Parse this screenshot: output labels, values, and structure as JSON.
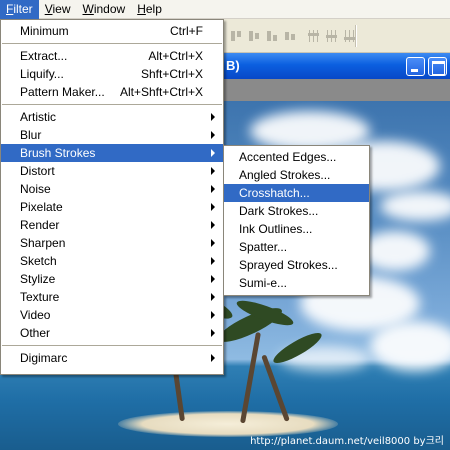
{
  "menubar": {
    "items": [
      {
        "label": "Filter",
        "mnemonic": "F"
      },
      {
        "label": "View",
        "mnemonic": "V"
      },
      {
        "label": "Window",
        "mnemonic": "W"
      },
      {
        "label": "Help",
        "mnemonic": "H"
      }
    ],
    "active": "Filter"
  },
  "document": {
    "title_fragment": "B)",
    "watermark": "http://planet.daum.net/veil8000 by크리"
  },
  "filter_menu": {
    "groups": [
      [
        {
          "label": "Minimum",
          "shortcut": "Ctrl+F"
        }
      ],
      [
        {
          "label": "Extract...",
          "shortcut": "Alt+Ctrl+X"
        },
        {
          "label": "Liquify...",
          "shortcut": "Shft+Ctrl+X"
        },
        {
          "label": "Pattern Maker...",
          "shortcut": "Alt+Shft+Ctrl+X"
        }
      ],
      [
        {
          "label": "Artistic",
          "submenu": true
        },
        {
          "label": "Blur",
          "submenu": true
        },
        {
          "label": "Brush Strokes",
          "submenu": true,
          "highlighted": true
        },
        {
          "label": "Distort",
          "submenu": true
        },
        {
          "label": "Noise",
          "submenu": true
        },
        {
          "label": "Pixelate",
          "submenu": true
        },
        {
          "label": "Render",
          "submenu": true
        },
        {
          "label": "Sharpen",
          "submenu": true
        },
        {
          "label": "Sketch",
          "submenu": true
        },
        {
          "label": "Stylize",
          "submenu": true
        },
        {
          "label": "Texture",
          "submenu": true
        },
        {
          "label": "Video",
          "submenu": true
        },
        {
          "label": "Other",
          "submenu": true
        }
      ],
      [
        {
          "label": "Digimarc",
          "submenu": true
        }
      ]
    ]
  },
  "brush_strokes_menu": {
    "items": [
      {
        "label": "Accented Edges..."
      },
      {
        "label": "Angled Strokes..."
      },
      {
        "label": "Crosshatch...",
        "highlighted": true
      },
      {
        "label": "Dark Strokes..."
      },
      {
        "label": "Ink Outlines..."
      },
      {
        "label": "Spatter..."
      },
      {
        "label": "Sprayed Strokes..."
      },
      {
        "label": "Sumi-e..."
      }
    ]
  },
  "colors": {
    "highlight": "#316ac5",
    "titlebar": "#0b5fe0",
    "menu_bg": "#ffffff"
  }
}
